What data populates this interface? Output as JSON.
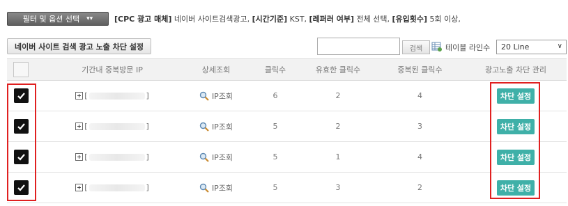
{
  "filter": {
    "button_label": "필터 및 옵션 선택",
    "summary_label_1": "[CPC 광고 매체]",
    "summary_value_1": " 네이버 사이트검색광고, ",
    "summary_label_2": "[시간기준]",
    "summary_value_2": " KST, ",
    "summary_label_3": "[레퍼러 여부]",
    "summary_value_3": " 전체 선택, ",
    "summary_label_4": "[유입횟수]",
    "summary_value_4": " 5회 이상,"
  },
  "toolbar": {
    "block_button_label": "네이버 사이트 검색 광고 노출 차단 설정",
    "search_value": "",
    "search_button_label": "검색",
    "rows_label": "테이블 라인수",
    "rows_select_value": "20 Line"
  },
  "table": {
    "headers": {
      "ip": "기간내 중복방문 IP",
      "detail": "상세조회",
      "clicks": "클릭수",
      "valid": "유효한 클릭수",
      "dup": "중복된 클릭수",
      "block": "광고노출 차단 관리"
    },
    "rows": [
      {
        "ip_open": "[",
        "ip_close": "]",
        "detail": "IP조회",
        "clicks": "6",
        "valid": "2",
        "dup": "4",
        "block": "차단 설정",
        "checked": true
      },
      {
        "ip_open": "[",
        "ip_close": "]",
        "detail": "IP조회",
        "clicks": "5",
        "valid": "2",
        "dup": "3",
        "block": "차단 설정",
        "checked": true
      },
      {
        "ip_open": "[",
        "ip_close": "]",
        "detail": "IP조회",
        "clicks": "5",
        "valid": "1",
        "dup": "4",
        "block": "차단 설정",
        "checked": true
      },
      {
        "ip_open": "[",
        "ip_close": "]",
        "detail": "IP조회",
        "clicks": "5",
        "valid": "3",
        "dup": "2",
        "block": "차단 설정",
        "checked": true
      }
    ]
  },
  "colors": {
    "accent_button": "#3fb0a8",
    "highlight": "#e02020",
    "checkbox_checked": "#111111"
  }
}
